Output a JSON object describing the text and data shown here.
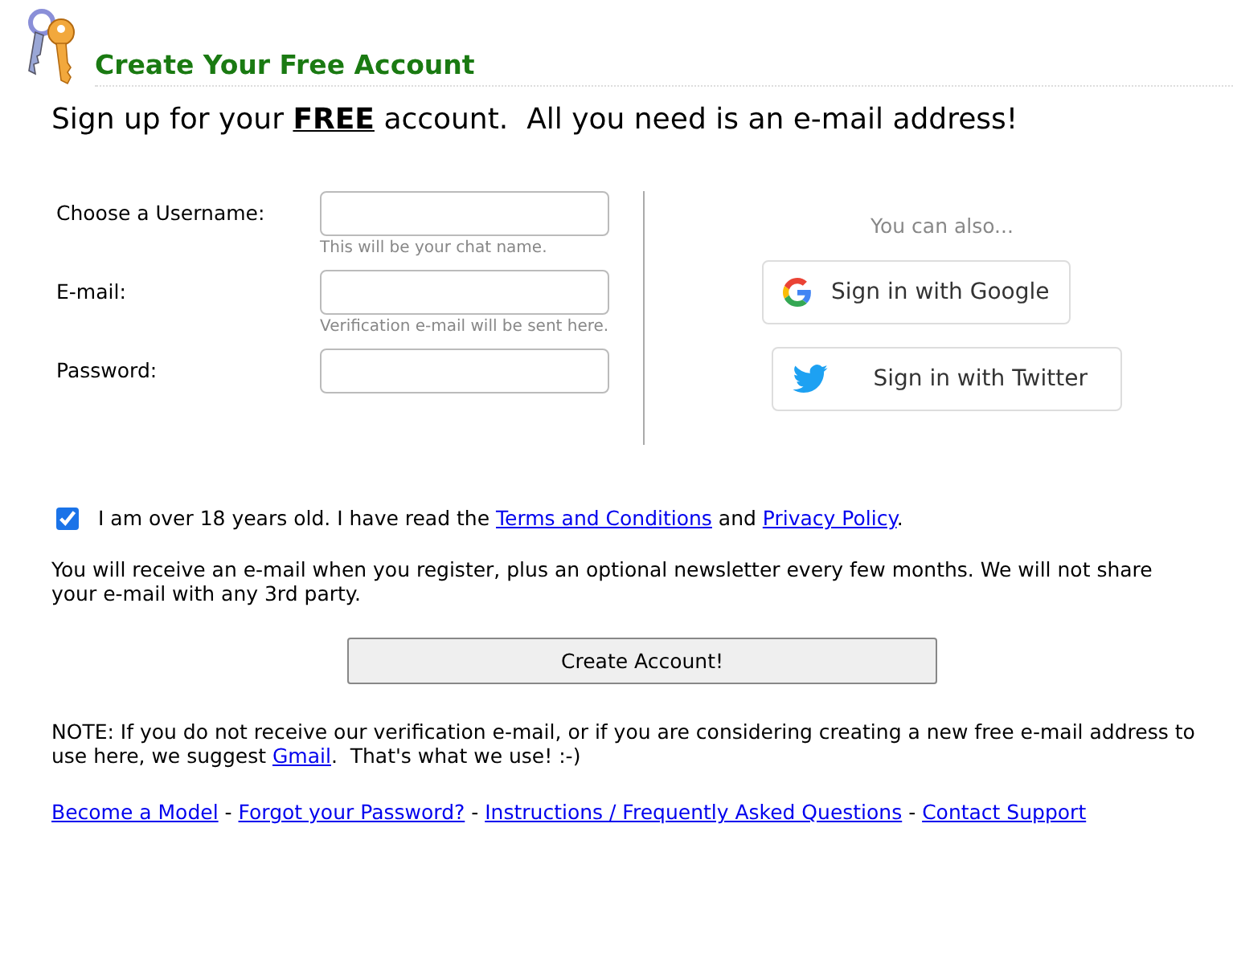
{
  "header": {
    "title": "Create Your Free Account"
  },
  "headline": [
    {
      "kind": "text",
      "text": "Sign up for your "
    },
    {
      "kind": "strong",
      "text": "FREE"
    },
    {
      "kind": "text",
      "text": " account.  All you need is an e-mail address!"
    }
  ],
  "fields": [
    {
      "label": "Choose a Username:",
      "hint": "This will be your chat name."
    },
    {
      "label": "E-mail:",
      "hint": "Verification e-mail will be sent here."
    },
    {
      "label": "Password:"
    }
  ],
  "social": {
    "intro": "You can also...",
    "buttons": [
      {
        "kind": "google",
        "label": "Sign in with Google"
      },
      {
        "kind": "twitter",
        "label": "Sign in with Twitter"
      }
    ]
  },
  "agree": {
    "checked": true,
    "parts": [
      {
        "kind": "text",
        "text": "I am over 18 years old. I have read the "
      },
      {
        "kind": "link",
        "text": "Terms and Conditions"
      },
      {
        "kind": "text",
        "text": " and "
      },
      {
        "kind": "link",
        "text": "Privacy Policy"
      },
      {
        "kind": "text",
        "text": "."
      }
    ]
  },
  "notice": "You will receive an e-mail when you register, plus an optional newsletter every few months. We will not share your e-mail with any 3rd party.",
  "submit": "Create Account!",
  "note": [
    {
      "kind": "text",
      "text": "NOTE: If you do not receive our verification e-mail, or if you are considering creating a new free e-mail address to use here, we suggest "
    },
    {
      "kind": "link",
      "text": "Gmail"
    },
    {
      "kind": "text",
      "text": ".  That's what we use! :-)"
    }
  ],
  "footer": [
    {
      "kind": "link",
      "text": "Become a Model"
    },
    {
      "kind": "text",
      "text": " - "
    },
    {
      "kind": "link",
      "text": "Forgot your Password?"
    },
    {
      "kind": "text",
      "text": " - "
    },
    {
      "kind": "link",
      "text": "Instructions / Frequently Asked Questions"
    },
    {
      "kind": "text",
      "text": " - "
    },
    {
      "kind": "link",
      "text": "Contact Support"
    }
  ]
}
